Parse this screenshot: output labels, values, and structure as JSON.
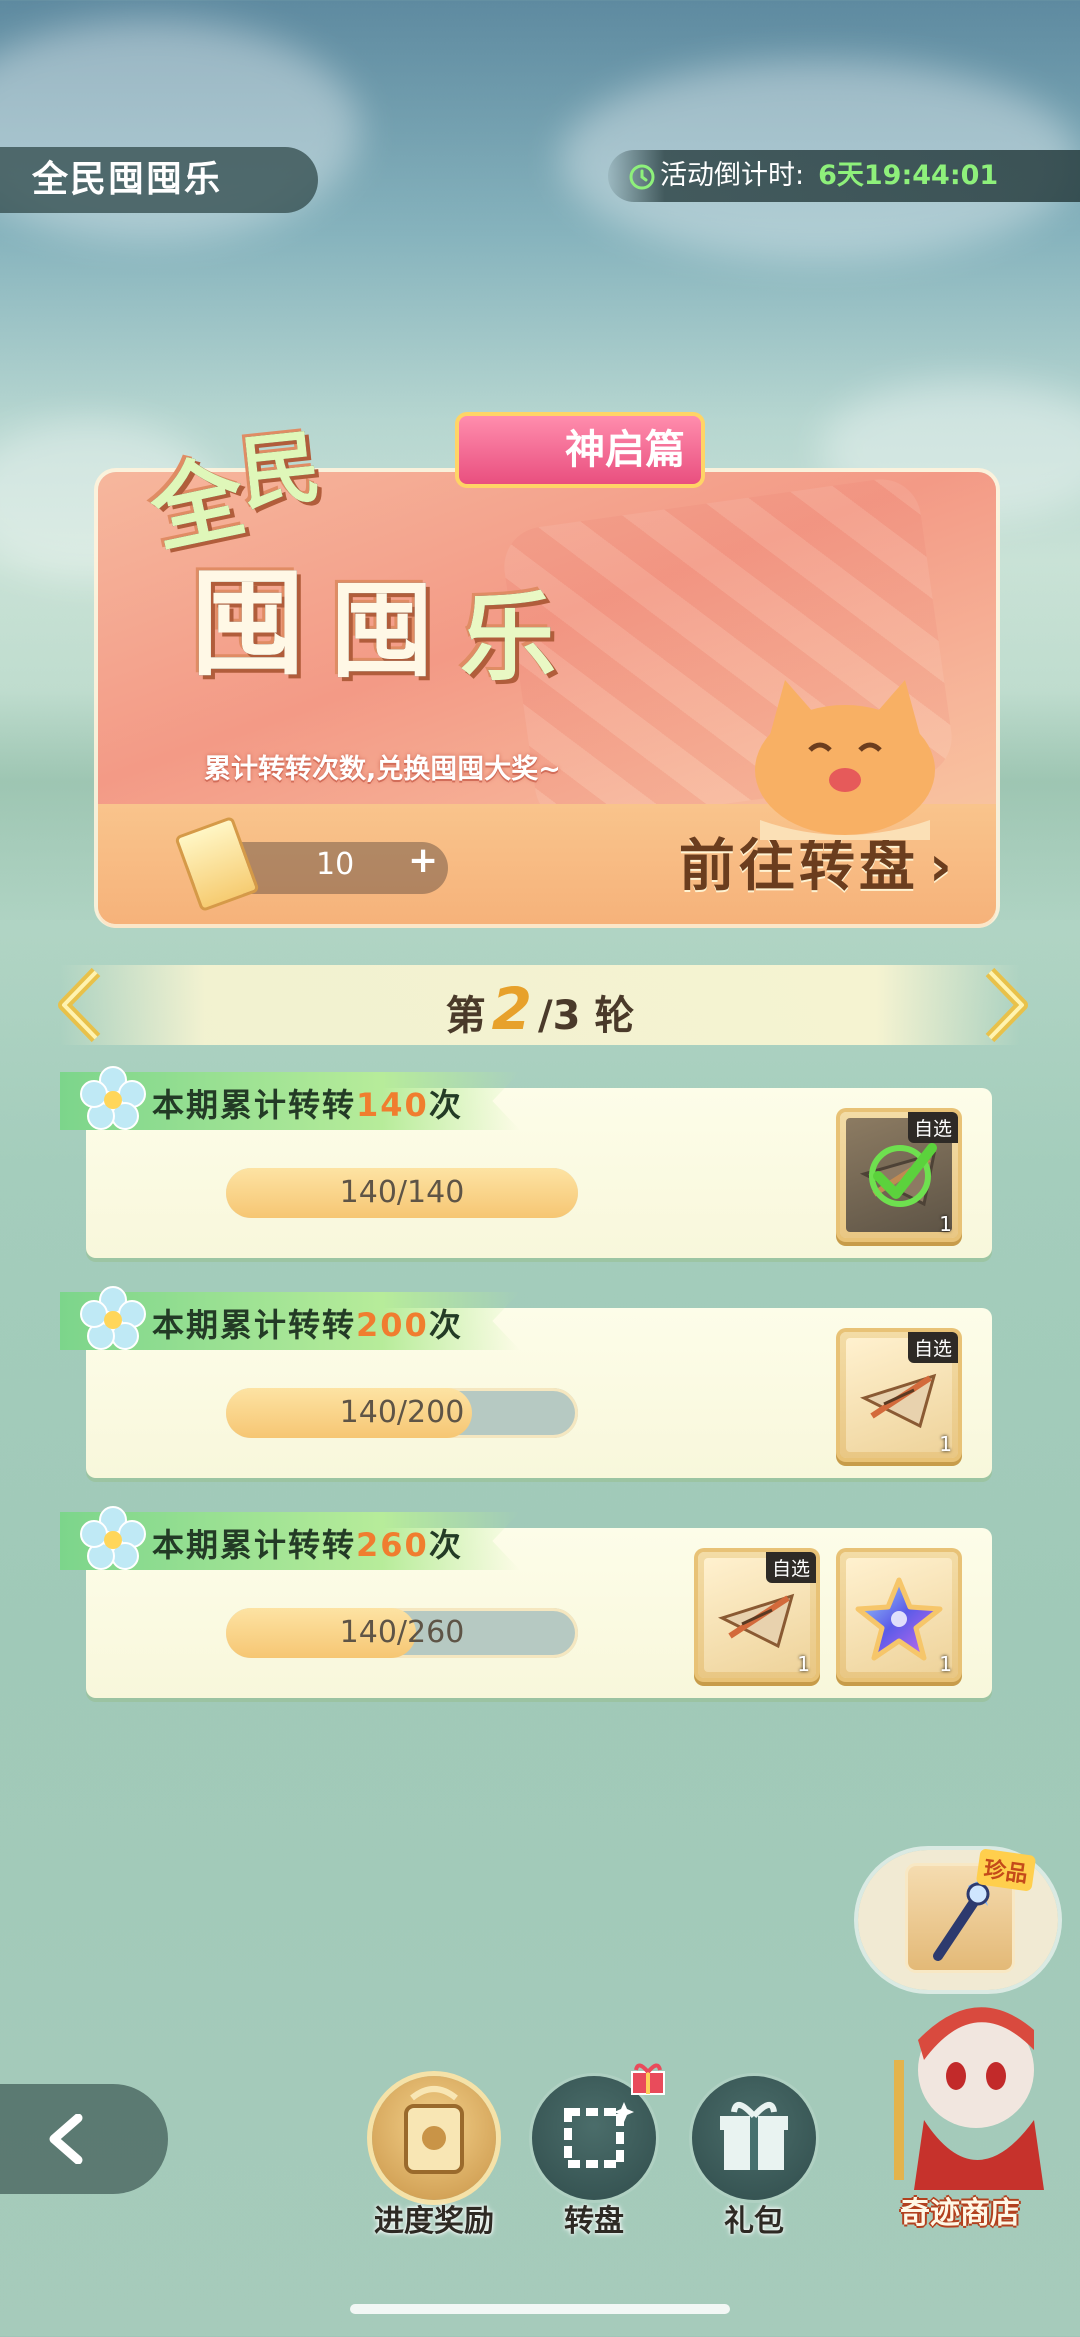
{
  "header": {
    "title": "全民囤囤乐",
    "countdown_label": "活动倒计时:",
    "countdown_value": "6天19:44:01"
  },
  "banner": {
    "logo_chars": [
      "全",
      "民",
      "囤",
      "囤",
      "乐"
    ],
    "badge": "神启篇",
    "subtitle": "累计转转次数,兑换囤囤大奖~",
    "ticket_count": "10",
    "plus": "+",
    "go_label": "前往转盘",
    "go_arrow": "›"
  },
  "round": {
    "prefix": "第",
    "current": "2",
    "total": "/3",
    "suffix": "轮"
  },
  "tasks": [
    {
      "label_prefix": "本期累计转转",
      "target": "140",
      "label_suffix": "次",
      "progress_text": "140/140",
      "progress": 1.0,
      "rewards": [
        {
          "icon": "crossbow-reward-icon",
          "tag": "自选",
          "count": "1",
          "claimed": true
        }
      ]
    },
    {
      "label_prefix": "本期累计转转",
      "target": "200",
      "label_suffix": "次",
      "progress_text": "140/200",
      "progress": 0.7,
      "rewards": [
        {
          "icon": "crossbow-reward-icon",
          "tag": "自选",
          "count": "1",
          "claimed": false
        }
      ]
    },
    {
      "label_prefix": "本期累计转转",
      "target": "260",
      "label_suffix": "次",
      "progress_text": "140/260",
      "progress": 0.54,
      "rewards": [
        {
          "icon": "crossbow-reward-icon",
          "tag": "自选",
          "count": "1",
          "claimed": false
        },
        {
          "icon": "star-crystal-icon",
          "tag": "",
          "count": "1",
          "claimed": false
        }
      ]
    }
  ],
  "shop": {
    "rare_tag": "珍品",
    "label": "奇迹商店"
  },
  "nav": {
    "progress_reward": "进度奖励",
    "wheel": "转盘",
    "gift": "礼包"
  },
  "colors": {
    "accent_orange": "#f07d2f",
    "countdown_green": "#8ef07b",
    "ribbon_green": "#7cd58b"
  }
}
